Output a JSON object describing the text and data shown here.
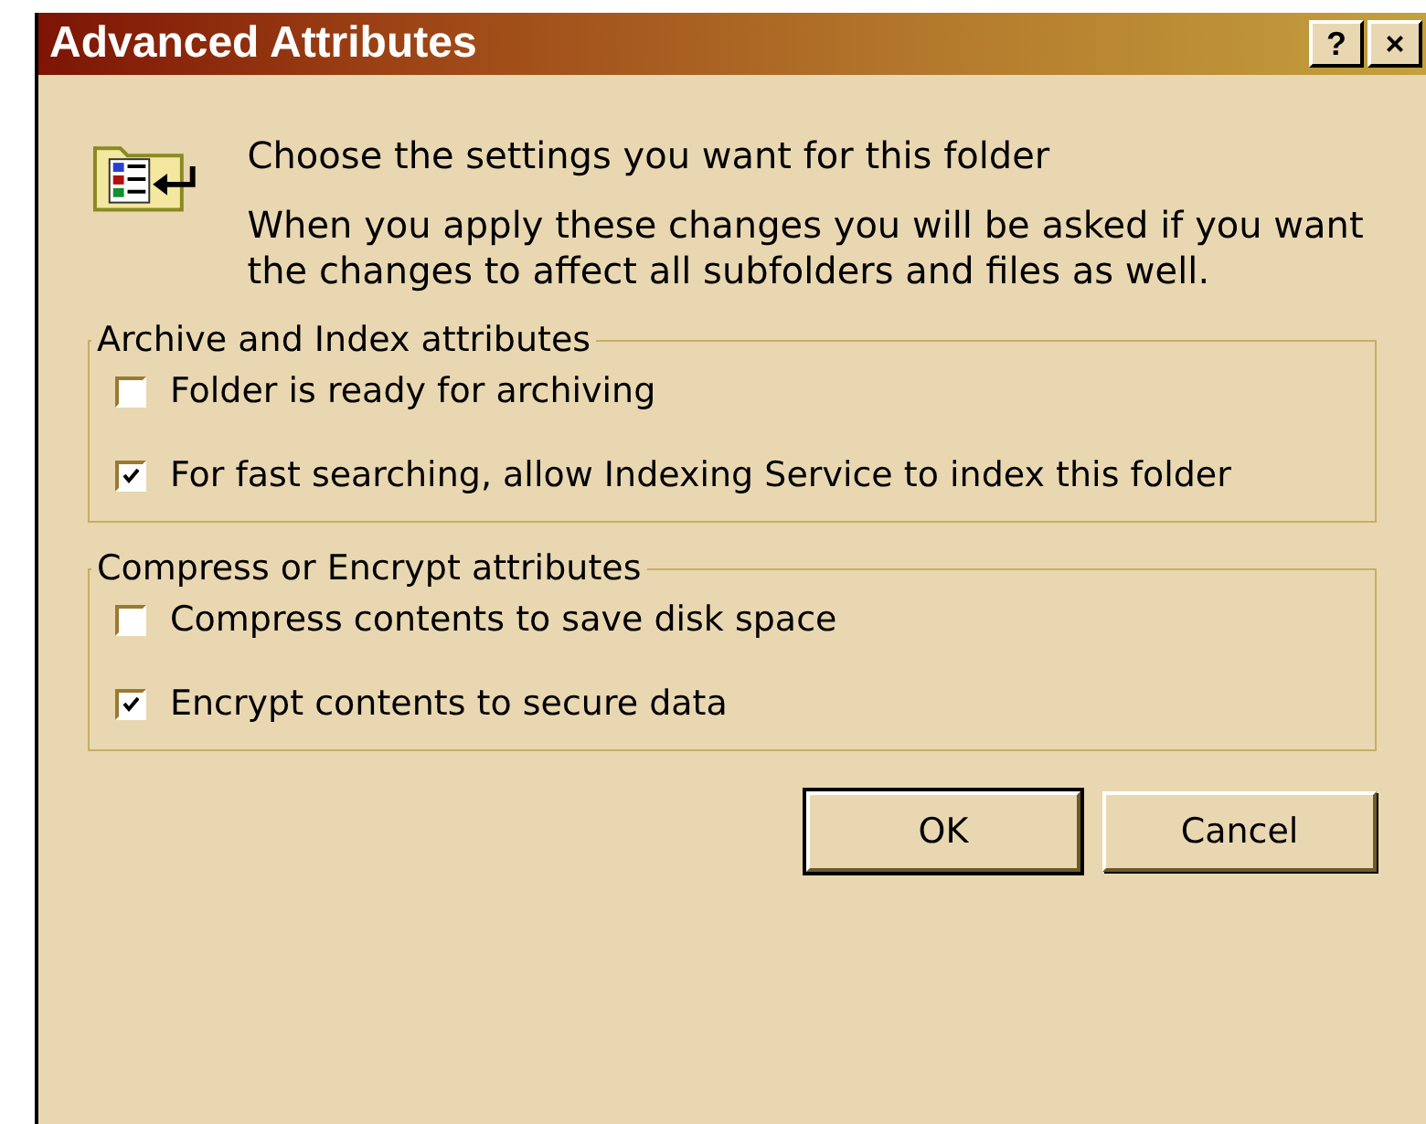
{
  "window": {
    "title": "Advanced Attributes",
    "title_buttons": [
      "?",
      "×"
    ]
  },
  "intro": {
    "heading": "Choose the settings you want for this folder",
    "note": "When you apply these changes you will be asked if you want the changes to affect all subfolders and files as well."
  },
  "groups": [
    {
      "title": "Archive and Index attributes",
      "options": [
        {
          "label": "Folder is ready for archiving",
          "checked": false
        },
        {
          "label": "For fast searching, allow Indexing Service to index this folder",
          "checked": true
        }
      ]
    },
    {
      "title": "Compress or Encrypt attributes",
      "options": [
        {
          "label": "Compress contents to save disk space",
          "checked": false
        },
        {
          "label": "Encrypt contents to secure data",
          "checked": true
        }
      ]
    }
  ],
  "buttons": [
    {
      "label": "OK",
      "default": true
    },
    {
      "label": "Cancel",
      "default": false
    }
  ]
}
